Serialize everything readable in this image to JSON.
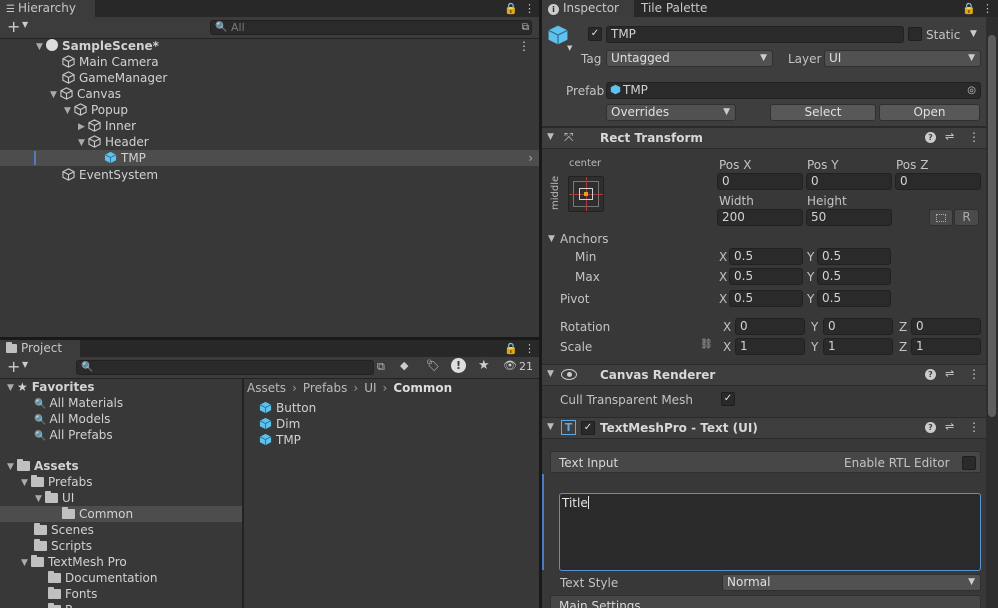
{
  "hierarchy": {
    "tab": "Hierarchy",
    "search_placeholder": "All",
    "items": [
      {
        "label": "SampleScene*"
      },
      {
        "label": "Main Camera"
      },
      {
        "label": "GameManager"
      },
      {
        "label": "Canvas"
      },
      {
        "label": "Popup"
      },
      {
        "label": "Inner"
      },
      {
        "label": "Header"
      },
      {
        "label": "TMP"
      },
      {
        "label": "EventSystem"
      }
    ]
  },
  "project": {
    "tab": "Project",
    "hidden_count": "21",
    "tree": [
      {
        "label": "Favorites"
      },
      {
        "label": "All Materials"
      },
      {
        "label": "All Models"
      },
      {
        "label": "All Prefabs"
      },
      {
        "label": "Assets"
      },
      {
        "label": "Prefabs"
      },
      {
        "label": "UI"
      },
      {
        "label": "Common"
      },
      {
        "label": "Scenes"
      },
      {
        "label": "Scripts"
      },
      {
        "label": "TextMesh Pro"
      },
      {
        "label": "Documentation"
      },
      {
        "label": "Fonts"
      },
      {
        "label": "R"
      }
    ],
    "breadcrumb": [
      "Assets",
      "Prefabs",
      "UI",
      "Common"
    ],
    "files": [
      {
        "label": "Button"
      },
      {
        "label": "Dim"
      },
      {
        "label": "TMP"
      }
    ]
  },
  "inspector": {
    "tabs": [
      "Inspector",
      "Tile Palette"
    ],
    "object_name": "TMP",
    "static_label": "Static",
    "tag_label": "Tag",
    "tag_value": "Untagged",
    "layer_label": "Layer",
    "layer_value": "UI",
    "prefab_label": "Prefab",
    "prefab_value": "TMP",
    "overrides_label": "Overrides",
    "select_label": "Select",
    "open_label": "Open",
    "rect_transform": {
      "title": "Rect Transform",
      "anchor_h": "center",
      "anchor_v": "middle",
      "pos_x_label": "Pos X",
      "pos_x": "0",
      "pos_y_label": "Pos Y",
      "pos_y": "0",
      "pos_z_label": "Pos Z",
      "pos_z": "0",
      "width_label": "Width",
      "width": "200",
      "height_label": "Height",
      "height": "50",
      "r_label": "R",
      "anchors_label": "Anchors",
      "min_label": "Min",
      "min_x": "0.5",
      "min_y": "0.5",
      "max_label": "Max",
      "max_x": "0.5",
      "max_y": "0.5",
      "pivot_label": "Pivot",
      "pivot_x": "0.5",
      "pivot_y": "0.5",
      "rotation_label": "Rotation",
      "rot_x": "0",
      "rot_y": "0",
      "rot_z": "0",
      "scale_label": "Scale",
      "scale_x": "1",
      "scale_y": "1",
      "scale_z": "1",
      "x": "X",
      "y": "Y",
      "z": "Z"
    },
    "canvas_renderer": {
      "title": "Canvas Renderer",
      "cull_label": "Cull Transparent Mesh"
    },
    "tmp": {
      "title": "TextMeshPro - Text (UI)",
      "text_input_label": "Text Input",
      "rtl_label": "Enable RTL Editor",
      "text_value": "Title",
      "text_style_label": "Text Style",
      "text_style_value": "Normal",
      "main_settings": "Main Settings"
    }
  },
  "colors": {
    "selection": "#4d4d4d",
    "accent": "#4c7dbe",
    "cube": "#5fc1ee"
  }
}
